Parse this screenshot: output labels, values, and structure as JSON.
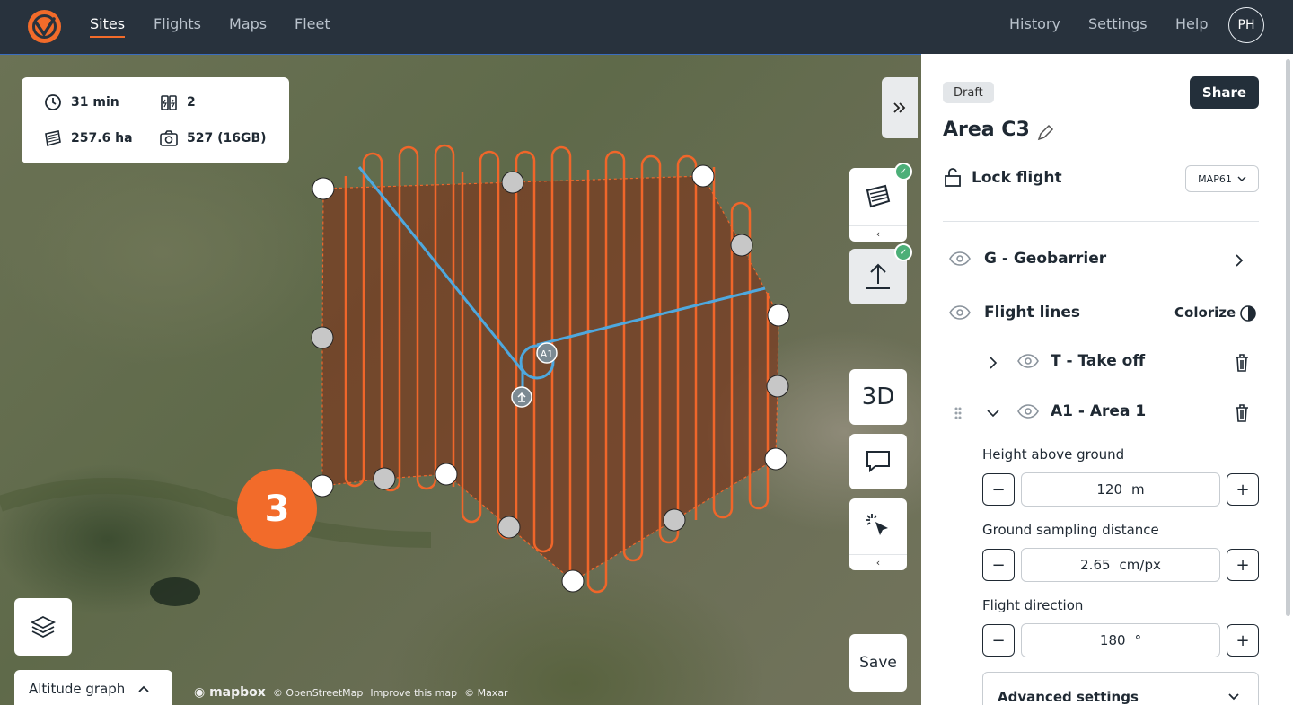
{
  "nav": {
    "logo": "brand-logo",
    "left": [
      "Sites",
      "Flights",
      "Maps",
      "Fleet"
    ],
    "active": "Sites",
    "right": [
      "History",
      "Settings",
      "Help"
    ],
    "avatar_initials": "PH"
  },
  "stats": {
    "duration": "31 min",
    "batteries": "2",
    "area": "257.6 ha",
    "photos": "527 (16GB)"
  },
  "map": {
    "labels": {
      "area_label": "A1"
    },
    "step_badge": "3",
    "view_toggle": "3D",
    "save": "Save",
    "altitude_graph": "Altitude graph",
    "attribution": {
      "mapbox": "mapbox",
      "osm": "© OpenStreetMap",
      "improve": "Improve this map",
      "maxar": "© Maxar"
    },
    "colors": {
      "flight_lines": "#f0662a",
      "route": "#4ea8de",
      "area_fill": "#7a3a20"
    }
  },
  "panel": {
    "status": "Draft",
    "share": "Share",
    "title": "Area C3",
    "lock_flight": "Lock flight",
    "map_select": "MAP61",
    "geobarrier": "G - Geobarrier",
    "flight_lines": "Flight lines",
    "colorize": "Colorize",
    "takeoff": "T - Take off",
    "area1": "A1 - Area 1",
    "fields": [
      {
        "label": "Height above ground",
        "value": "120",
        "unit": "m"
      },
      {
        "label": "Ground sampling distance",
        "value": "2.65",
        "unit": "cm/px"
      },
      {
        "label": "Flight direction",
        "value": "180",
        "unit": "°"
      }
    ],
    "advanced": "Advanced settings"
  }
}
